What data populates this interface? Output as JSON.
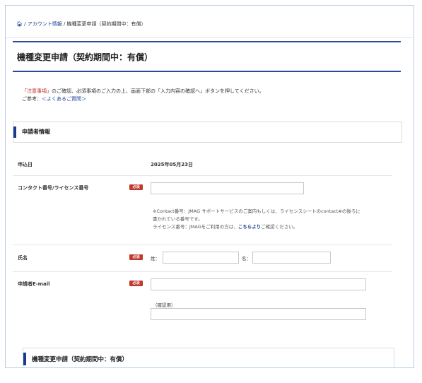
{
  "breadcrumb": {
    "home_icon": "home-icon",
    "separator": "/",
    "account_link": "アカウント情報",
    "current": "機種変更申請（契約期間中：有償）"
  },
  "page": {
    "title": "機種変更申請（契約期間中：有償）"
  },
  "intro": {
    "line1_link": "「注意事項」",
    "line1_text": "のご確認、必須事項のご入力の上、画面下部の「入力内容の確認へ」ボタンを押してください。",
    "line2_prefix": "ご参考：",
    "line2_link": "＜よくあるご質問＞"
  },
  "section_applicant": {
    "title": "申請者情報"
  },
  "form": {
    "required_badge": "必須",
    "date": {
      "label": "申込日",
      "value": "2025年05月23日"
    },
    "contact": {
      "label": "コンタクト番号/ライセンス番号",
      "value": "",
      "note_line1": "※Contact番号：JMAG サポートサービスのご案内もしくは、ライセンスシートのcontact#の後ろに",
      "note_line2": "書かれている番号です。",
      "note_line3_prefix": "ライセンス番号：JMAGをご利用の方は、",
      "note_line3_link": "こちらより",
      "note_line3_suffix": "ご確認ください。"
    },
    "name": {
      "label": "氏名",
      "last_label": "姓：",
      "first_label": "名：",
      "last_value": "",
      "first_value": ""
    },
    "email": {
      "label": "申請者E-mail",
      "value": "",
      "confirm_label": "（確認用）",
      "confirm_value": ""
    }
  },
  "section_change": {
    "title": "機種変更申請（契約期間中：有償）"
  },
  "colors": {
    "accent": "#1c3a8c",
    "required": "#c0392b",
    "link": "#1a3f93",
    "notice_red": "#c0271f"
  }
}
